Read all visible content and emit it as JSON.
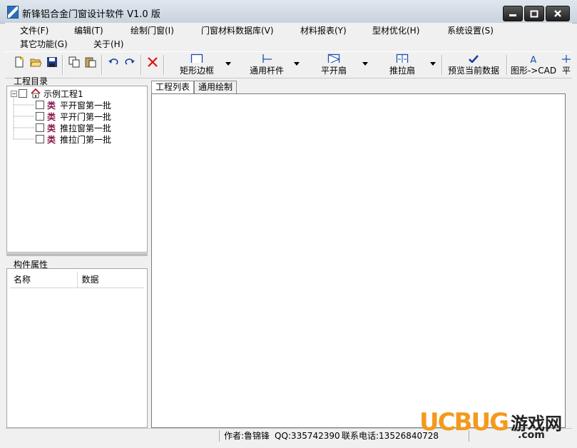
{
  "window": {
    "title": "新锋铝合金门窗设计软件 V1.0 版"
  },
  "menu": [
    {
      "label": "文件(F)"
    },
    {
      "label": "编辑(T)"
    },
    {
      "label": "绘制门窗(I)"
    },
    {
      "label": "门窗材料数据库(V)"
    },
    {
      "label": "材料报表(Y)"
    },
    {
      "label": "型材优化(H)"
    },
    {
      "label": "系统设置(S)"
    },
    {
      "label": "其它功能(G)"
    },
    {
      "label": "关于(H)"
    }
  ],
  "toolbar": {
    "rect_frame": "矩形边框",
    "general_bar": "通用杆件",
    "casement": "平开扇",
    "sliding": "推拉扇",
    "preview": "预览当前数据",
    "to_cad": "图形->CAD",
    "more": "平"
  },
  "tree": {
    "title": "工程目录",
    "root": "示例工程1",
    "items": [
      {
        "tag": "类",
        "label": "平开窗第一批"
      },
      {
        "tag": "类",
        "label": "平开门第一批"
      },
      {
        "tag": "类",
        "label": "推拉窗第一批"
      },
      {
        "tag": "类",
        "label": "推拉门第一批"
      }
    ]
  },
  "props": {
    "title": "构件属性",
    "col_name": "名称",
    "col_data": "数据"
  },
  "tabs": [
    {
      "label": "工程列表"
    },
    {
      "label": "通用绘制"
    }
  ],
  "status": {
    "author": "作者:鲁锦锋",
    "qq": "QQ:335742390",
    "phone": "联系电话:13526840728"
  },
  "watermark": {
    "brand": "UCBUG",
    "game": "游戏网",
    "domain": ".com"
  },
  "colors": {
    "brand_orange": "#f39a1e",
    "accent_blue": "#1a4fb0",
    "category_tag": "#8a1a4f"
  }
}
